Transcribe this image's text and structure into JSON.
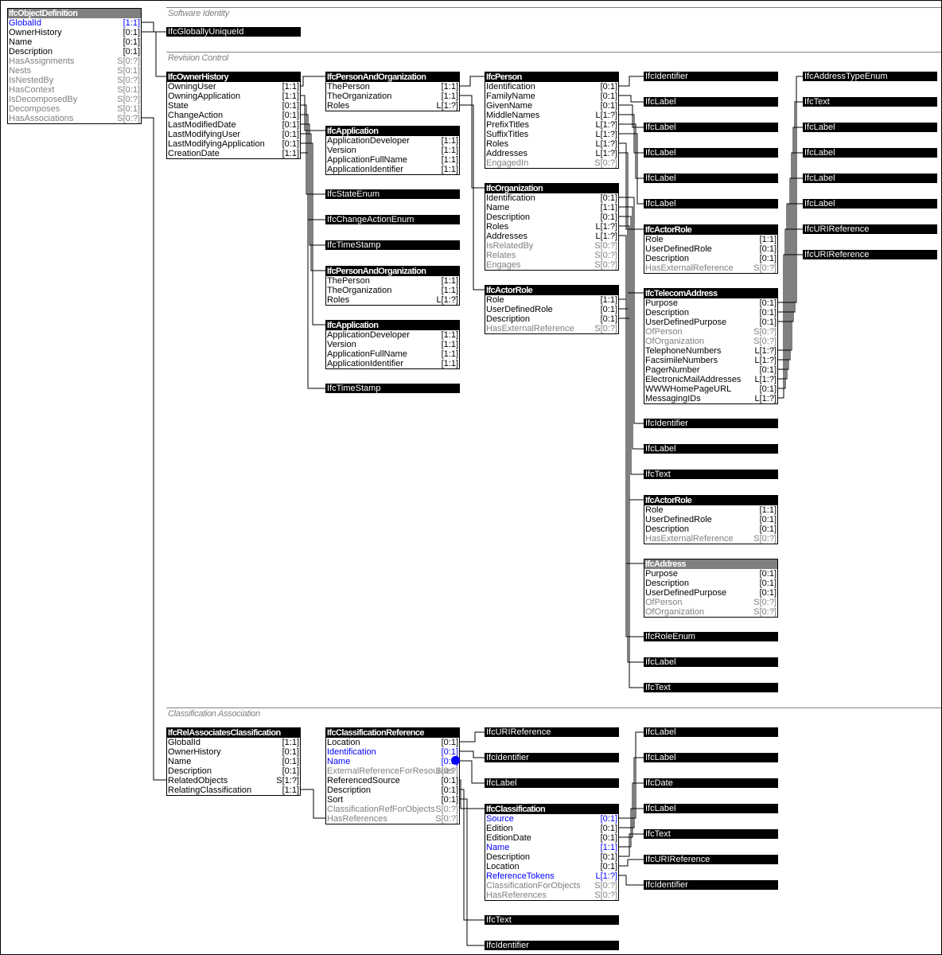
{
  "sections": {
    "software_identity": "Software Identity",
    "revision_control": "Revision Control",
    "classification_association": "Classification Association"
  },
  "colors": {
    "selected": "#0000ff",
    "inverse": "#808080",
    "header": "#000000",
    "root_header": "#808080"
  },
  "entities": {
    "objdef": {
      "title": "IfcObjectDefinition",
      "attrs": [
        {
          "n": "GlobalId",
          "c": "[1:1]",
          "k": "b"
        },
        {
          "n": "OwnerHistory",
          "c": "[0:1]",
          "k": "n"
        },
        {
          "n": "Name",
          "c": "[0:1]",
          "k": "n"
        },
        {
          "n": "Description",
          "c": "[0:1]",
          "k": "n"
        },
        {
          "n": "HasAssignments",
          "c": "S[0:?]",
          "k": "g"
        },
        {
          "n": "Nests",
          "c": "S[0:1]",
          "k": "g"
        },
        {
          "n": "IsNestedBy",
          "c": "S[0:?]",
          "k": "g"
        },
        {
          "n": "HasContext",
          "c": "S[0:1]",
          "k": "g"
        },
        {
          "n": "IsDecomposedBy",
          "c": "S[0:?]",
          "k": "g"
        },
        {
          "n": "Decomposes",
          "c": "S[0:1]",
          "k": "g"
        },
        {
          "n": "HasAssociations",
          "c": "S[0:?]",
          "k": "g"
        }
      ]
    },
    "guid": {
      "title": "IfcGloballyUniqueId"
    },
    "ownerhist": {
      "title": "IfcOwnerHistory",
      "attrs": [
        {
          "n": "OwningUser",
          "c": "[1:1]",
          "k": "n"
        },
        {
          "n": "OwningApplication",
          "c": "[1:1]",
          "k": "n"
        },
        {
          "n": "State",
          "c": "[0:1]",
          "k": "n"
        },
        {
          "n": "ChangeAction",
          "c": "[0:1]",
          "k": "n"
        },
        {
          "n": "LastModifiedDate",
          "c": "[0:1]",
          "k": "n"
        },
        {
          "n": "LastModifyingUser",
          "c": "[0:1]",
          "k": "n"
        },
        {
          "n": "LastModifyingApplication",
          "c": "[0:1]",
          "k": "n"
        },
        {
          "n": "CreationDate",
          "c": "[1:1]",
          "k": "n"
        }
      ]
    },
    "pao1": {
      "title": "IfcPersonAndOrganization",
      "attrs": [
        {
          "n": "ThePerson",
          "c": "[1:1]",
          "k": "n"
        },
        {
          "n": "TheOrganization",
          "c": "[1:1]",
          "k": "n"
        },
        {
          "n": "Roles",
          "c": "L[1:?]",
          "k": "n"
        }
      ]
    },
    "app1": {
      "title": "IfcApplication",
      "attrs": [
        {
          "n": "ApplicationDeveloper",
          "c": "[1:1]",
          "k": "n"
        },
        {
          "n": "Version",
          "c": "[1:1]",
          "k": "n"
        },
        {
          "n": "ApplicationFullName",
          "c": "[1:1]",
          "k": "n"
        },
        {
          "n": "ApplicationIdentifier",
          "c": "[1:1]",
          "k": "n"
        }
      ]
    },
    "stateenum": {
      "title": "IfcStateEnum"
    },
    "changeenum": {
      "title": "IfcChangeActionEnum"
    },
    "ts1": {
      "title": "IfcTimeStamp"
    },
    "pao2": {
      "title": "IfcPersonAndOrganization",
      "attrs": [
        {
          "n": "ThePerson",
          "c": "[1:1]",
          "k": "n"
        },
        {
          "n": "TheOrganization",
          "c": "[1:1]",
          "k": "n"
        },
        {
          "n": "Roles",
          "c": "L[1:?]",
          "k": "n"
        }
      ]
    },
    "app2": {
      "title": "IfcApplication",
      "attrs": [
        {
          "n": "ApplicationDeveloper",
          "c": "[1:1]",
          "k": "n"
        },
        {
          "n": "Version",
          "c": "[1:1]",
          "k": "n"
        },
        {
          "n": "ApplicationFullName",
          "c": "[1:1]",
          "k": "n"
        },
        {
          "n": "ApplicationIdentifier",
          "c": "[1:1]",
          "k": "n"
        }
      ]
    },
    "ts2": {
      "title": "IfcTimeStamp"
    },
    "person": {
      "title": "IfcPerson",
      "attrs": [
        {
          "n": "Identification",
          "c": "[0:1]",
          "k": "n"
        },
        {
          "n": "FamilyName",
          "c": "[0:1]",
          "k": "n"
        },
        {
          "n": "GivenName",
          "c": "[0:1]",
          "k": "n"
        },
        {
          "n": "MiddleNames",
          "c": "L[1:?]",
          "k": "n"
        },
        {
          "n": "PrefixTitles",
          "c": "L[1:?]",
          "k": "n"
        },
        {
          "n": "SuffixTitles",
          "c": "L[1:?]",
          "k": "n"
        },
        {
          "n": "Roles",
          "c": "L[1:?]",
          "k": "n"
        },
        {
          "n": "Addresses",
          "c": "L[1:?]",
          "k": "n"
        },
        {
          "n": "EngagedIn",
          "c": "S[0:?]",
          "k": "g"
        }
      ]
    },
    "org": {
      "title": "IfcOrganization",
      "attrs": [
        {
          "n": "Identification",
          "c": "[0:1]",
          "k": "n"
        },
        {
          "n": "Name",
          "c": "[1:1]",
          "k": "n"
        },
        {
          "n": "Description",
          "c": "[0:1]",
          "k": "n"
        },
        {
          "n": "Roles",
          "c": "L[1:?]",
          "k": "n"
        },
        {
          "n": "Addresses",
          "c": "L[1:?]",
          "k": "n"
        },
        {
          "n": "IsRelatedBy",
          "c": "S[0:?]",
          "k": "g"
        },
        {
          "n": "Relates",
          "c": "S[0:?]",
          "k": "g"
        },
        {
          "n": "Engages",
          "c": "S[0:?]",
          "k": "g"
        }
      ]
    },
    "role1": {
      "title": "IfcActorRole",
      "attrs": [
        {
          "n": "Role",
          "c": "[1:1]",
          "k": "n"
        },
        {
          "n": "UserDefinedRole",
          "c": "[0:1]",
          "k": "n"
        },
        {
          "n": "Description",
          "c": "[0:1]",
          "k": "n"
        },
        {
          "n": "HasExternalReference",
          "c": "S[0:?]",
          "k": "g"
        }
      ]
    },
    "p_ident": {
      "title": "IfcIdentifier"
    },
    "p_label1": {
      "title": "IfcLabel"
    },
    "p_label2": {
      "title": "IfcLabel"
    },
    "p_label3": {
      "title": "IfcLabel"
    },
    "p_label4": {
      "title": "IfcLabel"
    },
    "p_label5": {
      "title": "IfcLabel"
    },
    "role2": {
      "title": "IfcActorRole",
      "attrs": [
        {
          "n": "Role",
          "c": "[1:1]",
          "k": "n"
        },
        {
          "n": "UserDefinedRole",
          "c": "[0:1]",
          "k": "n"
        },
        {
          "n": "Description",
          "c": "[0:1]",
          "k": "n"
        },
        {
          "n": "HasExternalReference",
          "c": "S[0:?]",
          "k": "g"
        }
      ]
    },
    "telecom": {
      "title": "IfcTelecomAddress",
      "attrs": [
        {
          "n": "Purpose",
          "c": "[0:1]",
          "k": "n"
        },
        {
          "n": "Description",
          "c": "[0:1]",
          "k": "n"
        },
        {
          "n": "UserDefinedPurpose",
          "c": "[0:1]",
          "k": "n"
        },
        {
          "n": "OfPerson",
          "c": "S[0:?]",
          "k": "g"
        },
        {
          "n": "OfOrganization",
          "c": "S[0:?]",
          "k": "g"
        },
        {
          "n": "TelephoneNumbers",
          "c": "L[1:?]",
          "k": "n"
        },
        {
          "n": "FacsimileNumbers",
          "c": "L[1:?]",
          "k": "n"
        },
        {
          "n": "PagerNumber",
          "c": "[0:1]",
          "k": "n"
        },
        {
          "n": "ElectronicMailAddresses",
          "c": "L[1:?]",
          "k": "n"
        },
        {
          "n": "WWWHomePageURL",
          "c": "[0:1]",
          "k": "n"
        },
        {
          "n": "MessagingIDs",
          "c": "L[1:?]",
          "k": "n"
        }
      ]
    },
    "o_ident": {
      "title": "IfcIdentifier"
    },
    "o_label": {
      "title": "IfcLabel"
    },
    "o_text": {
      "title": "IfcText"
    },
    "role3": {
      "title": "IfcActorRole",
      "attrs": [
        {
          "n": "Role",
          "c": "[1:1]",
          "k": "n"
        },
        {
          "n": "UserDefinedRole",
          "c": "[0:1]",
          "k": "n"
        },
        {
          "n": "Description",
          "c": "[0:1]",
          "k": "n"
        },
        {
          "n": "HasExternalReference",
          "c": "S[0:?]",
          "k": "g"
        }
      ]
    },
    "address": {
      "title": "IfcAddress",
      "attrs": [
        {
          "n": "Purpose",
          "c": "[0:1]",
          "k": "n"
        },
        {
          "n": "Description",
          "c": "[0:1]",
          "k": "n"
        },
        {
          "n": "UserDefinedPurpose",
          "c": "[0:1]",
          "k": "n"
        },
        {
          "n": "OfPerson",
          "c": "S[0:?]",
          "k": "g"
        },
        {
          "n": "OfOrganization",
          "c": "S[0:?]",
          "k": "g"
        }
      ]
    },
    "roleenum": {
      "title": "IfcRoleEnum"
    },
    "r_label": {
      "title": "IfcLabel"
    },
    "r_text": {
      "title": "IfcText"
    },
    "t_enum": {
      "title": "IfcAddressTypeEnum"
    },
    "t_text": {
      "title": "IfcText"
    },
    "t_label1": {
      "title": "IfcLabel"
    },
    "t_label2": {
      "title": "IfcLabel"
    },
    "t_label3": {
      "title": "IfcLabel"
    },
    "t_label4": {
      "title": "IfcLabel"
    },
    "t_uri1": {
      "title": "IfcURIReference"
    },
    "t_uri2": {
      "title": "IfcURIReference"
    },
    "relassoc": {
      "title": "IfcRelAssociatesClassification",
      "attrs": [
        {
          "n": "GlobalId",
          "c": "[1:1]",
          "k": "n"
        },
        {
          "n": "OwnerHistory",
          "c": "[0:1]",
          "k": "n"
        },
        {
          "n": "Name",
          "c": "[0:1]",
          "k": "n"
        },
        {
          "n": "Description",
          "c": "[0:1]",
          "k": "n"
        },
        {
          "n": "RelatedObjects",
          "c": "S[1:?]",
          "k": "n"
        },
        {
          "n": "RelatingClassification",
          "c": "[1:1]",
          "k": "n"
        }
      ]
    },
    "classref": {
      "title": "IfcClassificationReference",
      "attrs": [
        {
          "n": "Location",
          "c": "[0:1]",
          "k": "n"
        },
        {
          "n": "Identification",
          "c": "[0:1]",
          "k": "b"
        },
        {
          "n": "Name",
          "c": "[0:1]",
          "k": "b"
        },
        {
          "n": "ExternalReferenceForResources",
          "c": "S[0:?]",
          "k": "g"
        },
        {
          "n": "ReferencedSource",
          "c": "[0:1]",
          "k": "n"
        },
        {
          "n": "Description",
          "c": "[0:1]",
          "k": "n"
        },
        {
          "n": "Sort",
          "c": "[0:1]",
          "k": "n"
        },
        {
          "n": "ClassificationRefForObjects",
          "c": "S[0:?]",
          "k": "g"
        },
        {
          "n": "HasReferences",
          "c": "S[0:?]",
          "k": "g"
        }
      ]
    },
    "c_uri": {
      "title": "IfcURIReference"
    },
    "c_ident": {
      "title": "IfcIdentifier"
    },
    "c_label": {
      "title": "IfcLabel"
    },
    "classif": {
      "title": "IfcClassification",
      "attrs": [
        {
          "n": "Source",
          "c": "[0:1]",
          "k": "b"
        },
        {
          "n": "Edition",
          "c": "[0:1]",
          "k": "n"
        },
        {
          "n": "EditionDate",
          "c": "[0:1]",
          "k": "n"
        },
        {
          "n": "Name",
          "c": "[1:1]",
          "k": "b"
        },
        {
          "n": "Description",
          "c": "[0:1]",
          "k": "n"
        },
        {
          "n": "Location",
          "c": "[0:1]",
          "k": "n"
        },
        {
          "n": "ReferenceTokens",
          "c": "L[1:?]",
          "k": "b"
        },
        {
          "n": "ClassificationForObjects",
          "c": "S[0:?]",
          "k": "g"
        },
        {
          "n": "HasReferences",
          "c": "S[0:?]",
          "k": "g"
        }
      ]
    },
    "c_text": {
      "title": "IfcText"
    },
    "c_ident2": {
      "title": "IfcIdentifier"
    },
    "k_label1": {
      "title": "IfcLabel"
    },
    "k_label2": {
      "title": "IfcLabel"
    },
    "k_date": {
      "title": "IfcDate"
    },
    "k_label3": {
      "title": "IfcLabel"
    },
    "k_text": {
      "title": "IfcText"
    },
    "k_uri": {
      "title": "IfcURIReference"
    },
    "k_ident": {
      "title": "IfcIdentifier"
    }
  }
}
